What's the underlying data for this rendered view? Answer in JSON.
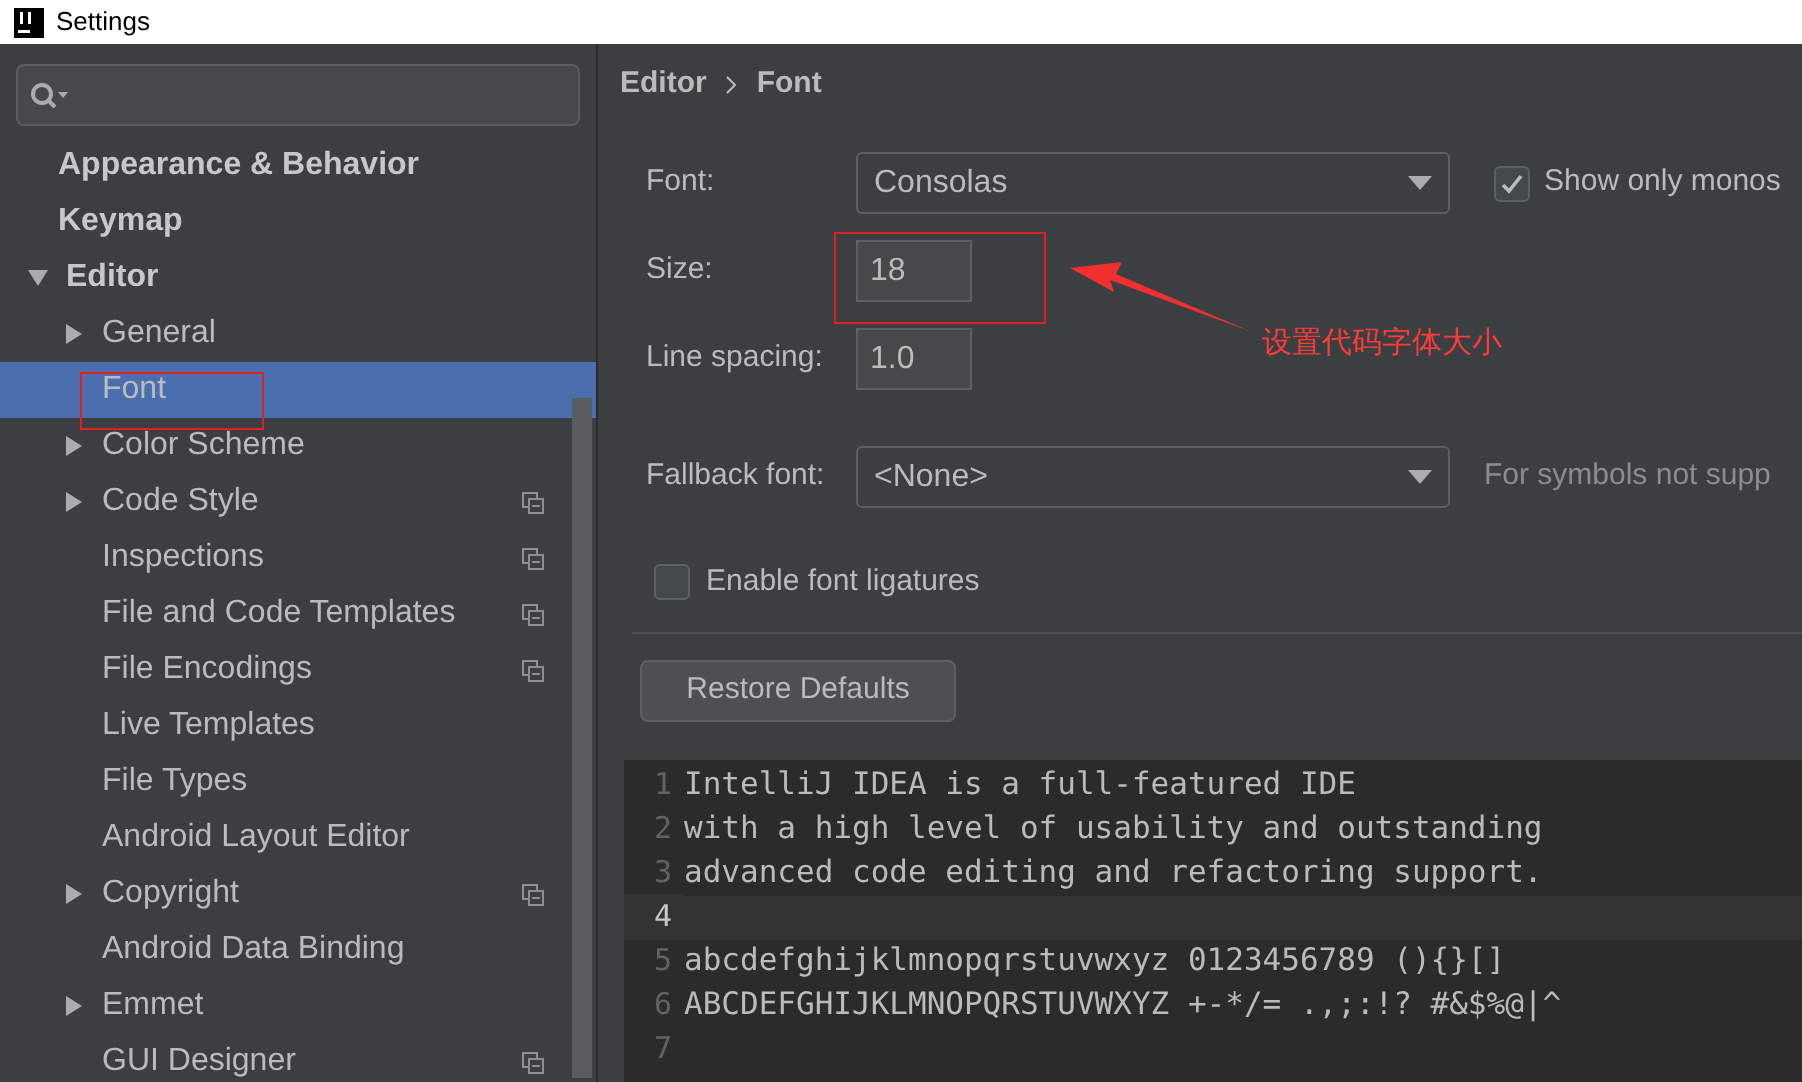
{
  "window": {
    "title": "Settings"
  },
  "sidebar": {
    "items": [
      {
        "label": "Appearance & Behavior",
        "kind": "leaf",
        "project_scope": false
      },
      {
        "label": "Keymap",
        "kind": "leaf",
        "project_scope": false
      },
      {
        "label": "Editor",
        "kind": "group",
        "expanded": true,
        "project_scope": false,
        "children": [
          {
            "label": "General",
            "kind": "group",
            "expanded": false,
            "selected": false,
            "project_scope": false
          },
          {
            "label": "Font",
            "kind": "leaf",
            "selected": true,
            "project_scope": false
          },
          {
            "label": "Color Scheme",
            "kind": "group",
            "expanded": false,
            "selected": false,
            "project_scope": false
          },
          {
            "label": "Code Style",
            "kind": "group",
            "expanded": false,
            "selected": false,
            "project_scope": true
          },
          {
            "label": "Inspections",
            "kind": "leaf",
            "selected": false,
            "project_scope": true
          },
          {
            "label": "File and Code Templates",
            "kind": "leaf",
            "selected": false,
            "project_scope": true
          },
          {
            "label": "File Encodings",
            "kind": "leaf",
            "selected": false,
            "project_scope": true
          },
          {
            "label": "Live Templates",
            "kind": "leaf",
            "selected": false,
            "project_scope": false
          },
          {
            "label": "File Types",
            "kind": "leaf",
            "selected": false,
            "project_scope": false
          },
          {
            "label": "Android Layout Editor",
            "kind": "leaf",
            "selected": false,
            "project_scope": false
          },
          {
            "label": "Copyright",
            "kind": "group",
            "expanded": false,
            "selected": false,
            "project_scope": true
          },
          {
            "label": "Android Data Binding",
            "kind": "leaf",
            "selected": false,
            "project_scope": false
          },
          {
            "label": "Emmet",
            "kind": "group",
            "expanded": false,
            "selected": false,
            "project_scope": false
          },
          {
            "label": "GUI Designer",
            "kind": "leaf",
            "selected": false,
            "project_scope": true
          }
        ]
      }
    ]
  },
  "breadcrumb": [
    "Editor",
    "Font"
  ],
  "form": {
    "font": {
      "label": "Font:",
      "value": "Consolas"
    },
    "show_only_monospaced": {
      "label": "Show only monos",
      "checked": true
    },
    "size": {
      "label": "Size:",
      "value": "18"
    },
    "line_spacing": {
      "label": "Line spacing:",
      "value": "1.0"
    },
    "fallback_font": {
      "label": "Fallback font:",
      "value": "<None>",
      "hint": "For symbols not supp"
    },
    "ligatures": {
      "label": "Enable font ligatures",
      "checked": false
    },
    "restore_button": "Restore Defaults"
  },
  "preview": {
    "lines": [
      {
        "number": "1",
        "text": "IntelliJ IDEA is a full-featured IDE",
        "current": false
      },
      {
        "number": "2",
        "text": "with a high level of usability and outstanding",
        "current": false
      },
      {
        "number": "3",
        "text": "advanced code editing and refactoring support.",
        "current": false
      },
      {
        "number": "4",
        "current": true
      },
      {
        "number": "5",
        "text": "abcdefghijklmnopqrstuvwxyz 0123456789 (){}[]",
        "current": false
      },
      {
        "number": "6",
        "text": "ABCDEFGHIJKLMNOPQRSTUVWXYZ +-*/= .,;:!? #&$%@|^",
        "current": false
      },
      {
        "number": "7",
        "current": false
      }
    ]
  },
  "annotation": {
    "text": "设置代码字体大小"
  }
}
